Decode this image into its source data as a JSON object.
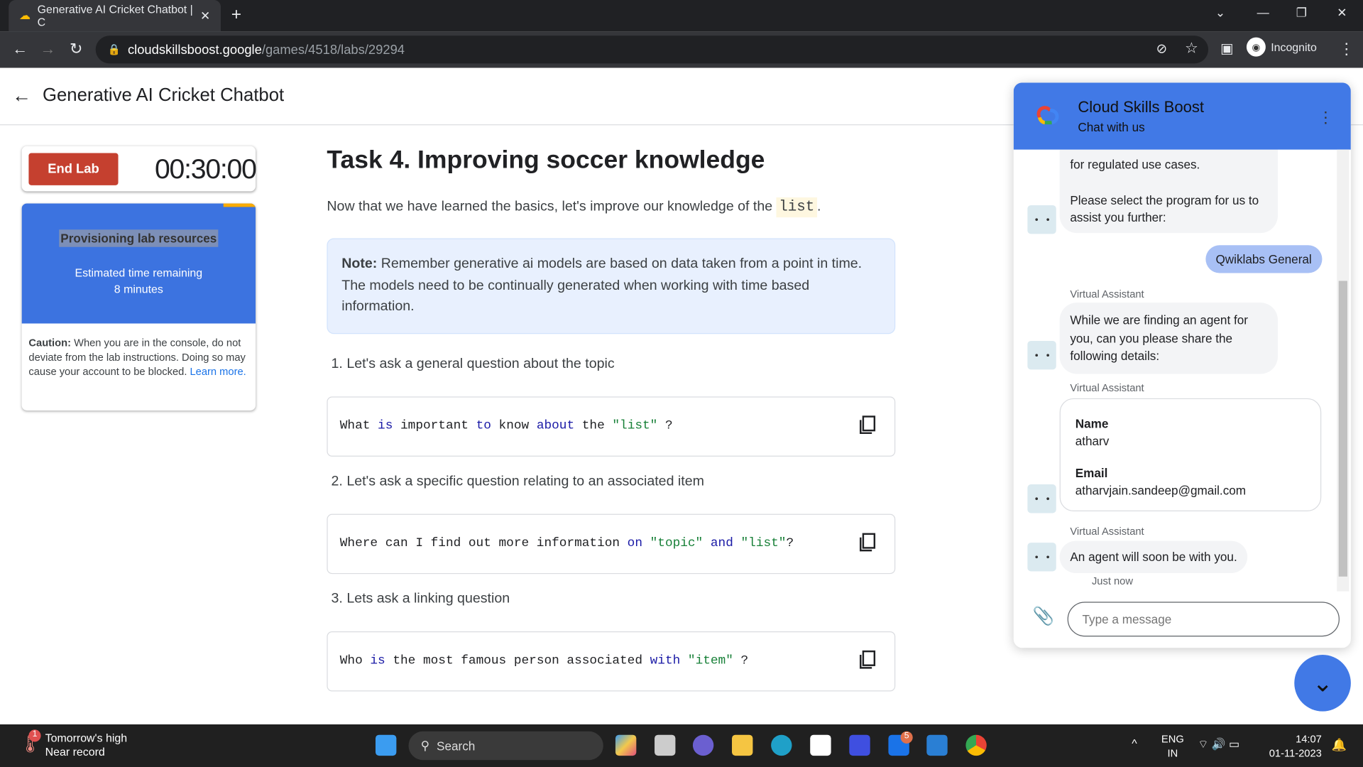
{
  "browser": {
    "tab_title": "Generative AI Cricket Chatbot | C",
    "url_host": "cloudskillsboost.google",
    "url_path": "/games/4518/labs/29294",
    "profile": "Incognito"
  },
  "page": {
    "title": "Generative AI Cricket Chatbot"
  },
  "lab": {
    "end_label": "End Lab",
    "timer": "00:30:00",
    "prov_title": "Provisioning lab resources",
    "prov_sub": "Estimated time remaining",
    "prov_time": "8 minutes",
    "caution_label": "Caution:",
    "caution_text": " When you are in the console, do not deviate from the lab instructions. Doing so may cause your account to be blocked. ",
    "learn_more": "Learn more."
  },
  "task": {
    "title": "Task 4. Improving soccer knowledge",
    "intro": "Now that we have learned the basics, let's improve our knowledge of the ",
    "intro_code": "list",
    "intro_end": ".",
    "note_label": "Note:",
    "note_text": " Remember generative ai models are based on data taken from a point in time. The models need to be continually generated when working with time based information.",
    "steps": [
      {
        "label": "1. Let's ask a general question about the topic",
        "code": [
          [
            "What ",
            ""
          ],
          [
            "is",
            "kw"
          ],
          [
            " important ",
            ""
          ],
          [
            "to",
            "kw"
          ],
          [
            " know ",
            ""
          ],
          [
            "about",
            "kw"
          ],
          [
            " the ",
            ""
          ],
          [
            "\"list\"",
            "st"
          ],
          [
            " ?",
            ""
          ]
        ]
      },
      {
        "label": "2. Let's ask a specific question relating to an associated item",
        "code": [
          [
            "Where can I find out more information ",
            ""
          ],
          [
            "on",
            "kw"
          ],
          [
            " ",
            ""
          ],
          [
            "\"topic\"",
            "st"
          ],
          [
            " ",
            ""
          ],
          [
            "and",
            "kw"
          ],
          [
            " ",
            ""
          ],
          [
            "\"list\"",
            "st"
          ],
          [
            "?",
            ""
          ]
        ]
      },
      {
        "label": "3. Lets ask a linking question",
        "code": [
          [
            "Who ",
            ""
          ],
          [
            "is",
            "kw"
          ],
          [
            " the most famous person associated ",
            ""
          ],
          [
            "with",
            "kw"
          ],
          [
            " ",
            ""
          ],
          [
            "\"item\"",
            "st"
          ],
          [
            " ?",
            ""
          ]
        ]
      }
    ]
  },
  "chat": {
    "title": "Cloud Skills Boost",
    "subtitle": "Chat with us",
    "msg1a": "for regulated use cases.",
    "msg1b": "Please select the program for us to assist you further:",
    "user_reply": "Qwiklabs General",
    "va": "Virtual Assistant",
    "msg2": "While we are finding an agent for you,  can you please share the following details:",
    "name_label": "Name",
    "name_value": "atharv",
    "email_label": "Email",
    "email_value": "atharvjain.sandeep@gmail.com",
    "msg3": "An agent will soon be with you.",
    "time": "Just now",
    "placeholder": "Type a message"
  },
  "taskbar": {
    "weather1": "Tomorrow's high",
    "weather2": "Near record",
    "weather_badge": "1",
    "search": "Search",
    "lang1": "ENG",
    "lang2": "IN",
    "time": "14:07",
    "date": "01-11-2023",
    "mail_badge": "5"
  }
}
